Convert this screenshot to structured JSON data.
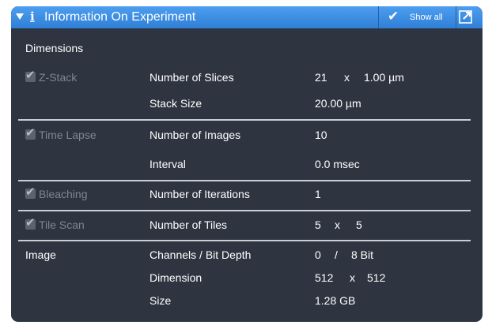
{
  "header": {
    "title": "Information On Experiment",
    "show_all_label": "Show all",
    "info_glyph": "i",
    "icons": [
      "collapse-arrow-icon",
      "info-icon",
      "checkmark-icon",
      "popout-icon"
    ],
    "accent_color": "#2f7fd6"
  },
  "dimensions": {
    "section_label": "Dimensions",
    "z_stack": {
      "checkbox_label": "Z-Stack",
      "checked": true,
      "number_of_slices_label": "Number of Slices",
      "number_of_slices_count": "21",
      "times": "x",
      "slice_interval": "1.00 µm",
      "stack_size_label": "Stack Size",
      "stack_size_value": "20.00 µm"
    },
    "time_lapse": {
      "checkbox_label": "Time Lapse",
      "checked": true,
      "number_of_images_label": "Number of Images",
      "number_of_images_value": "10",
      "interval_label": "Interval",
      "interval_value": "0.0 msec"
    },
    "bleaching": {
      "checkbox_label": "Bleaching",
      "checked": true,
      "number_of_iterations_label": "Number of Iterations",
      "number_of_iterations_value": "1"
    },
    "tile_scan": {
      "checkbox_label": "Tile Scan",
      "checked": true,
      "number_of_tiles_label": "Number of Tiles",
      "tiles_x": "5",
      "times": "x",
      "tiles_y": "5"
    }
  },
  "image": {
    "section_label": "Image",
    "channels_label": "Channels / Bit Depth",
    "channels_value": "0",
    "slash": "/",
    "bit_depth_value": "8 Bit",
    "dimension_label": "Dimension",
    "dimension_width": "512",
    "times": "x",
    "dimension_height": "512",
    "size_label": "Size",
    "size_value": "1.28 GB"
  }
}
